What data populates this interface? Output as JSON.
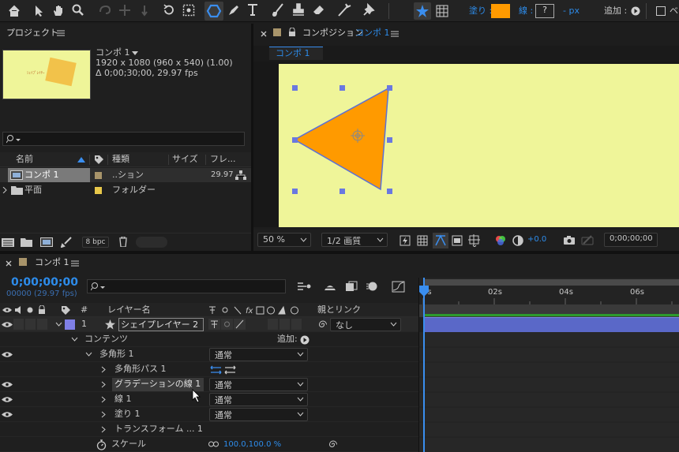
{
  "toolbar": {
    "fill_label": "塗り :",
    "fill_color": "#ff9a00",
    "stroke_label": "線 :",
    "stroke_value": "?",
    "px_label": "- px",
    "add_label": "追加 :",
    "extra_label": "ベ"
  },
  "project": {
    "title": "プロジェクト",
    "comp_name": "コンポ 1",
    "comp_info1": "1920 x 1080  (960 x 540) (1.00)",
    "comp_info2": "Δ 0;00;30;00, 29.97 fps",
    "thumb_text": "ｼｪｲﾌﾟﾚｲﾔｰ",
    "search_placeholder": "",
    "col_name": "名前",
    "col_type": "種類",
    "col_size": "サイズ",
    "col_fps": "フレ...",
    "items": [
      {
        "name": "コンポ 1",
        "type": "..ション",
        "fps": "29.97",
        "label_color": "#a8946a"
      },
      {
        "name": "平面",
        "type": "フォルダー",
        "fps": "",
        "label_color": "#e8c84a"
      }
    ],
    "bpc": "8 bpc"
  },
  "comp_viewer": {
    "title_prefix": "コンポジション",
    "title_name": "コンポ 1",
    "tab": "コンポ 1",
    "bg_color": "#eff599",
    "shape_color": "#ff9a00",
    "zoom": "50 %",
    "quality": "1/2 画質",
    "exposure": "+0.0",
    "timecode": "0;00;00;00"
  },
  "timeline": {
    "tab": "コンポ 1",
    "timecode": "0;00;00;00",
    "frames": "00000 (29.97 fps)",
    "col_num": "#",
    "col_layer": "レイヤー名",
    "col_parent": "親とリンク",
    "ruler": [
      "0s",
      "02s",
      "04s",
      "06s"
    ],
    "layer": {
      "num": "1",
      "name": "シェイプレイヤー 2",
      "parent": "なし",
      "label_color": "#7f7fe6"
    },
    "contents_label": "コンテンツ",
    "add_label": "追加:",
    "rows": [
      {
        "name": "多角形 1",
        "mode": "通常"
      },
      {
        "name": "多角形パス 1",
        "mode": ""
      },
      {
        "name": "グラデーションの線 1",
        "mode": "通常"
      },
      {
        "name": "線 1",
        "mode": "通常"
      },
      {
        "name": "塗り 1",
        "mode": "通常"
      },
      {
        "name": "トランスフォーム ... 1",
        "mode": ""
      }
    ],
    "scale_label": "スケール",
    "scale_value": "100.0,100.0 %"
  }
}
